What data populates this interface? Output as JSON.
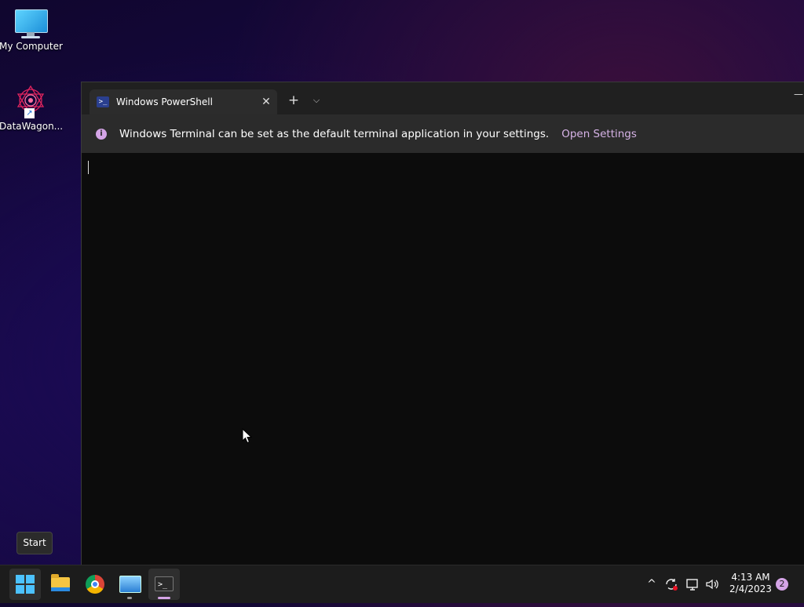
{
  "desktop": {
    "icons": [
      {
        "label": "My Computer",
        "icon": "monitor-icon"
      },
      {
        "label": "DataWagon...",
        "icon": "datawagon-icon"
      }
    ]
  },
  "terminal": {
    "tab": {
      "title": "Windows PowerShell",
      "icon": "powershell-icon",
      "close_glyph": "✕"
    },
    "new_tab_glyph": "+",
    "dropdown_glyph": "⌵",
    "minimize_glyph": "—",
    "infobar": {
      "icon_glyph": "i",
      "message": "Windows Terminal can be set as the default terminal application in your settings.",
      "link": "Open Settings"
    }
  },
  "tooltip": {
    "text": "Start"
  },
  "taskbar": {
    "apps": [
      "start",
      "file-explorer",
      "chrome",
      "remote-desktop",
      "terminal"
    ],
    "tray": {
      "chevron_glyph": "^",
      "time": "4:13 AM",
      "date": "2/4/2023",
      "notification_count": "2"
    }
  },
  "colors": {
    "accent": "#d4a4e6",
    "windows_blue": "#4cc2ff",
    "terminal_bg": "#0c0c0c"
  }
}
